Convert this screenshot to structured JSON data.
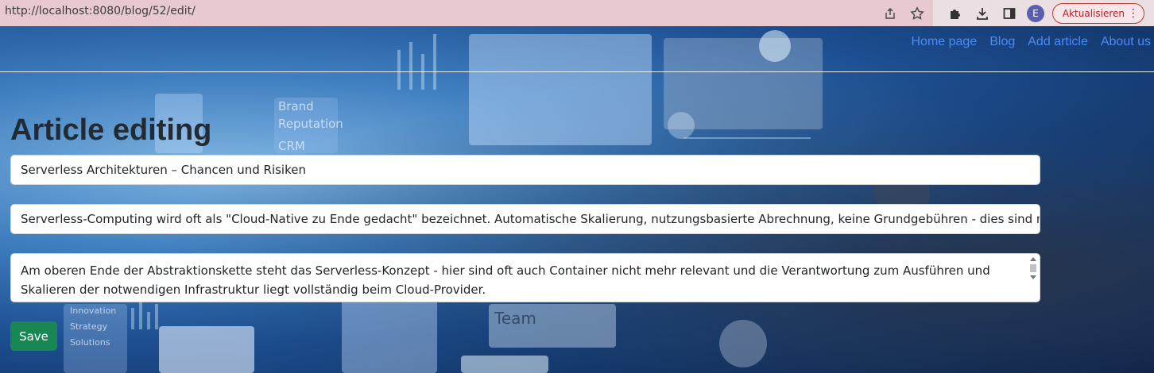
{
  "browser": {
    "url": "http://localhost:8080/blog/52/edit/",
    "avatar_letter": "E",
    "update_label": "Aktualisieren"
  },
  "nav": {
    "items": [
      {
        "label": "Home page"
      },
      {
        "label": "Blog"
      },
      {
        "label": "Add article"
      },
      {
        "label": "About us"
      }
    ]
  },
  "page": {
    "title": "Article editing",
    "title_field": "Serverless Architekturen – Chancen und Risiken",
    "intro_field": "Serverless-Computing wird oft als \"Cloud-Native zu Ende gedacht\" bezeichnet. Automatische Skalierung, nutzungsbasierte Abrechnung, keine Grundgebühren - dies sind nur einige",
    "body_field": "Am oberen Ende der Abstraktionskette steht das Serverless-Konzept - hier sind oft auch Container nicht mehr relevant und die Verantwortung zum Ausführen und Skalieren der notwendigen Infrastruktur liegt vollständig beim Cloud-Provider.",
    "save_label": "Save"
  },
  "background": {
    "labels": [
      "Brand",
      "Reputation",
      "CRM",
      "Team",
      "Innovation",
      "Strategy",
      "Solutions"
    ]
  },
  "colors": {
    "nav_link": "#4a8cf7",
    "save_button": "#198754",
    "update_border": "#c0392b"
  }
}
